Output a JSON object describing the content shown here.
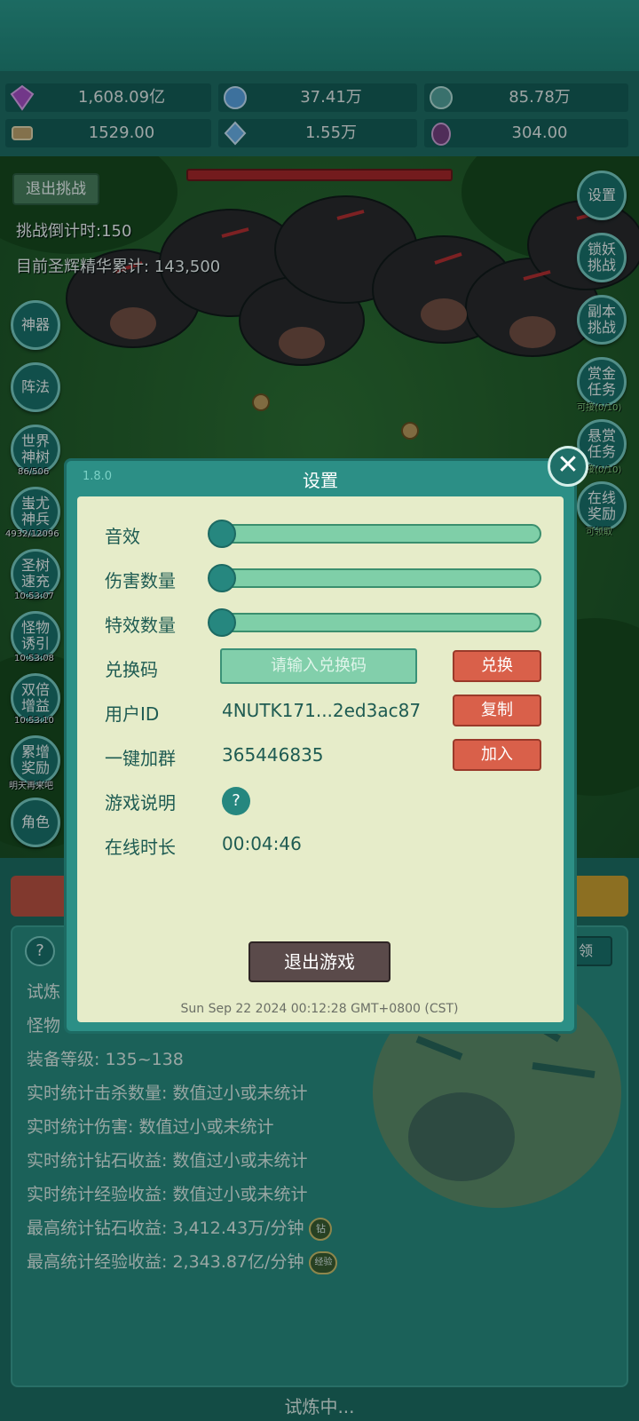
{
  "resources": [
    {
      "icon": "gem-icon",
      "value": "1,608.09亿",
      "color": "#b04ac8"
    },
    {
      "icon": "crystal-ore-icon",
      "value": "37.41万",
      "color": "#5fa4e6"
    },
    {
      "icon": "orb-icon",
      "value": "85.78万",
      "color": "#58a39d"
    },
    {
      "icon": "scroll-icon",
      "value": "1529.00",
      "color": "#c9a46a"
    },
    {
      "icon": "shard-icon",
      "value": "1.55万",
      "color": "#6fb3ee"
    },
    {
      "icon": "egg-icon",
      "value": "304.00",
      "color": "#7b3b7e"
    }
  ],
  "battle": {
    "quit_challenge": "退出挑战",
    "countdown": "挑战倒计时:150",
    "essence": "目前圣辉精华累计: 143,500"
  },
  "left_menu": [
    {
      "label": "神器",
      "sub": ""
    },
    {
      "label": "阵法",
      "sub": ""
    },
    {
      "label": "世界神树",
      "sub": "86/506"
    },
    {
      "label": "蚩尤神兵",
      "sub": "4932/12096"
    },
    {
      "label": "圣树速充",
      "sub": "10:53:07"
    },
    {
      "label": "怪物诱引",
      "sub": "10:53:08"
    },
    {
      "label": "双倍增益",
      "sub": "10:53:10"
    },
    {
      "label": "累增奖励",
      "sub": "明天再来吧"
    },
    {
      "label": "角色",
      "sub": ""
    }
  ],
  "right_menu": [
    {
      "label": "设置",
      "sub": ""
    },
    {
      "label": "锁妖挑战",
      "sub": ""
    },
    {
      "label": "副本挑战",
      "sub": ""
    },
    {
      "label": "赏金任务",
      "sub": "可接(0/10)"
    },
    {
      "label": "悬赏任务",
      "sub": "接(0/10)"
    },
    {
      "label": "在线奖励",
      "sub": "可领取"
    }
  ],
  "dialog": {
    "version": "1.8.0",
    "title": "设置",
    "sound_label": "音效",
    "sound_value": 0,
    "damage_count_label": "伤害数量",
    "damage_count_value": 0,
    "effect_count_label": "特效数量",
    "effect_count_value": 0,
    "redeem_label": "兑换码",
    "redeem_placeholder": "请输入兑换码",
    "redeem_button": "兑换",
    "user_id_label": "用户ID",
    "user_id": "4NUTK171...2ed3ac87",
    "copy_button": "复制",
    "group_label": "一键加群",
    "group_number": "365446835",
    "join_button": "加入",
    "guide_label": "游戏说明",
    "guide_icon": "?",
    "online_label": "在线时长",
    "online_time": "00:04:46",
    "exit_game": "退出游戏",
    "datetime": "Sun Sep 22 2024 00:12:28 GMT+0800 (CST)"
  },
  "panel": {
    "help": "?",
    "tab_right": "领",
    "line1": "试炼",
    "line2": "怪物",
    "equip_level": "装备等级: 135~138",
    "kill_stat": "实时统计击杀数量: 数值过小或未统计",
    "damage_stat": "实时统计伤害: 数值过小或未统计",
    "diamond_stat": "实时统计钻石收益: 数值过小或未统计",
    "exp_stat": "实时统计经验收益: 数值过小或未统计",
    "max_diamond": "最高统计钻石收益: 3,412.43万/分钟",
    "max_diamond_tag": "钻",
    "max_exp": "最高统计经验收益: 2,343.87亿/分钟",
    "max_exp_tag": "经验",
    "status": "试炼中..."
  }
}
